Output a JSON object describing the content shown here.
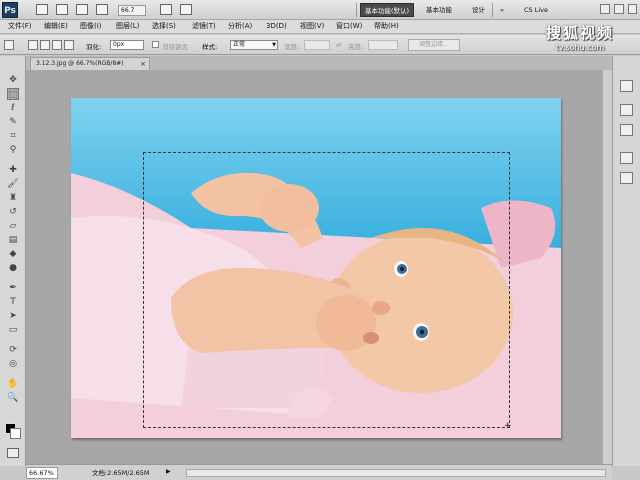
{
  "app": {
    "logo": "Ps",
    "zoom_display": "66.7",
    "workspace_buttons": [
      "基本功能(默认)",
      "基本功能",
      "设计"
    ],
    "cs_live": "CS Live"
  },
  "menu": {
    "items": [
      "文件(F)",
      "编辑(E)",
      "图像(I)",
      "图层(L)",
      "选择(S)",
      "滤镜(T)",
      "分析(A)",
      "3D(D)",
      "视图(V)",
      "窗口(W)",
      "帮助(H)"
    ]
  },
  "options": {
    "feather_label": "羽化:",
    "feather_value": "0px",
    "antialias_label": "消除锯齿",
    "style_label": "样式:",
    "style_value": "正常",
    "width_label": "宽度:",
    "height_label": "高度:",
    "refine_edge": "调整边缘..."
  },
  "document": {
    "tab_title": "3.12.3.jpg @ 66.7%(RGB/8#)"
  },
  "status": {
    "zoom": "66.67%",
    "doc_info": "文档:2.65M/2.65M"
  },
  "watermark": {
    "brand": "搜狐视频",
    "url": "tv.sohu.com"
  },
  "colors": {
    "foreground": "#000000",
    "background": "#ffffff"
  }
}
